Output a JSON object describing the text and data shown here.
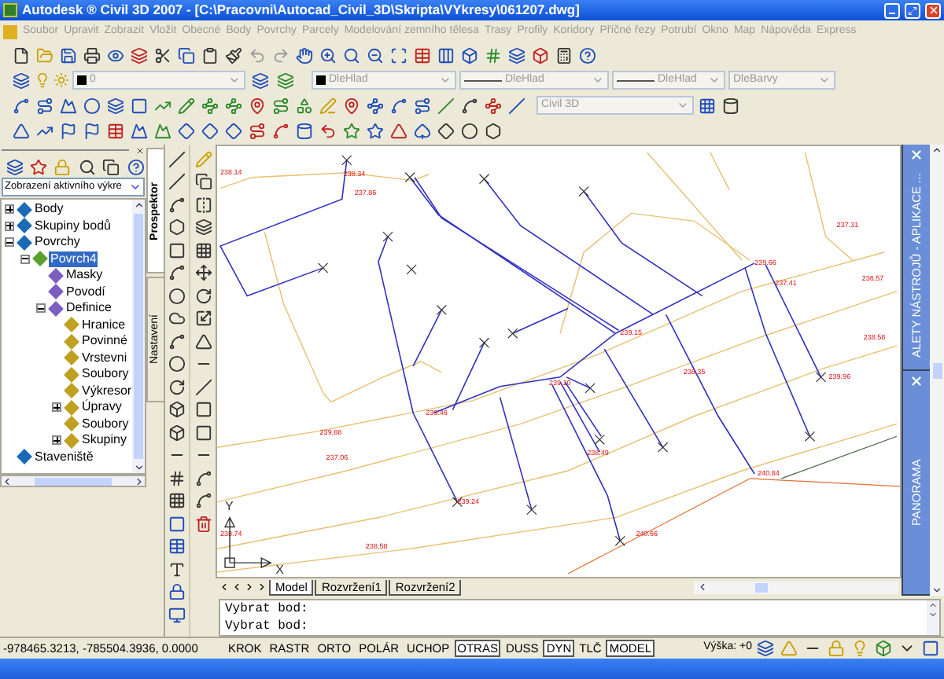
{
  "window": {
    "title": "Autodesk ® Civil 3D 2007 - [C:\\Pracovni\\Autocad_Civil_3D\\Skripta\\VYkresy\\061207.dwg]"
  },
  "menu": [
    "Soubor",
    "Upravit",
    "Zobrazit",
    "Vložit",
    "Obecné",
    "Body",
    "Povrchy",
    "Parcely",
    "Modelování zemního tělesa",
    "Trasy",
    "Profily",
    "Koridory",
    "Příčné řezy",
    "Potrubí",
    "Okno",
    "Map",
    "Nápověda",
    "Express"
  ],
  "properties_toolbar": {
    "layer": "0",
    "color_control": "DleHlad",
    "linetype": "DleHlad",
    "lineweight": "DleHlad",
    "plot_style": "DleBarvy"
  },
  "civil_toolbar": {
    "style": "Civil 3D"
  },
  "toolspace": {
    "view": "Zobrazení aktivního výkre",
    "tabs": [
      {
        "label": "Prospektor",
        "selected": true
      },
      {
        "label": "Nastavení",
        "selected": false
      }
    ],
    "tree": [
      {
        "label": "Body",
        "expanded": false,
        "selected": false
      },
      {
        "label": "Skupiny bodů",
        "expanded": false,
        "selected": false
      },
      {
        "label": "Povrchy",
        "expanded": true,
        "selected": false,
        "children": [
          {
            "label": "Povrch4",
            "expanded": true,
            "selected": true,
            "children": [
              {
                "label": "Masky",
                "selected": false
              },
              {
                "label": "Povodí",
                "selected": false
              },
              {
                "label": "Definice",
                "expanded": true,
                "selected": false,
                "children": [
                  {
                    "label": "Hranice",
                    "selected": false
                  },
                  {
                    "label": "Povinné",
                    "selected": false
                  },
                  {
                    "label": "Vrstevni",
                    "selected": false
                  },
                  {
                    "label": "Soubory",
                    "selected": false
                  },
                  {
                    "label": "Výkresor",
                    "selected": false
                  },
                  {
                    "label": "Úpravy",
                    "expanded": false,
                    "selected": false
                  },
                  {
                    "label": "Soubory",
                    "selected": false
                  },
                  {
                    "label": "Skupiny",
                    "expanded": false,
                    "selected": false
                  }
                ]
              }
            ]
          }
        ]
      },
      {
        "label": "Staveniště",
        "selected": false
      }
    ]
  },
  "drawing": {
    "elevation_labels": [
      "238.14",
      "238.34",
      "237.86",
      "237.31",
      "239.66",
      "237.41",
      "236.57",
      "239.15",
      "238.58",
      "238.35",
      "239.10",
      "239.46",
      "239.88",
      "237.06",
      "238.49",
      "239.96",
      "240.84",
      "239.24",
      "238.74",
      "238.58",
      "240.66"
    ],
    "ucs": {
      "x": "X",
      "y": "Y"
    }
  },
  "layout_tabs": [
    {
      "label": "Model",
      "selected": true
    },
    {
      "label": "Rozvržení1",
      "selected": false
    },
    {
      "label": "Rozvržení2",
      "selected": false
    }
  ],
  "palettes": [
    {
      "title": "ALETY NÁSTROJŮ - APLIKACE ..."
    },
    {
      "title": "PANORAMA"
    }
  ],
  "command_lines": [
    "Vybrat bod:",
    "Vybrat bod:"
  ],
  "status_bar": {
    "coordinates": "-978465.3213, -785504.3936, 0.0000",
    "toggles": [
      {
        "label": "KROK",
        "on": false
      },
      {
        "label": "RASTR",
        "on": false
      },
      {
        "label": "ORTO",
        "on": false
      },
      {
        "label": "POLÁR",
        "on": false
      },
      {
        "label": "UCHOP",
        "on": false
      },
      {
        "label": "OTRAS",
        "on": true
      },
      {
        "label": "DUSS",
        "on": false
      },
      {
        "label": "DYN",
        "on": true
      },
      {
        "label": "TLČ",
        "on": false
      },
      {
        "label": "MODEL",
        "on": true
      }
    ],
    "elevation": "Výška: +0"
  }
}
